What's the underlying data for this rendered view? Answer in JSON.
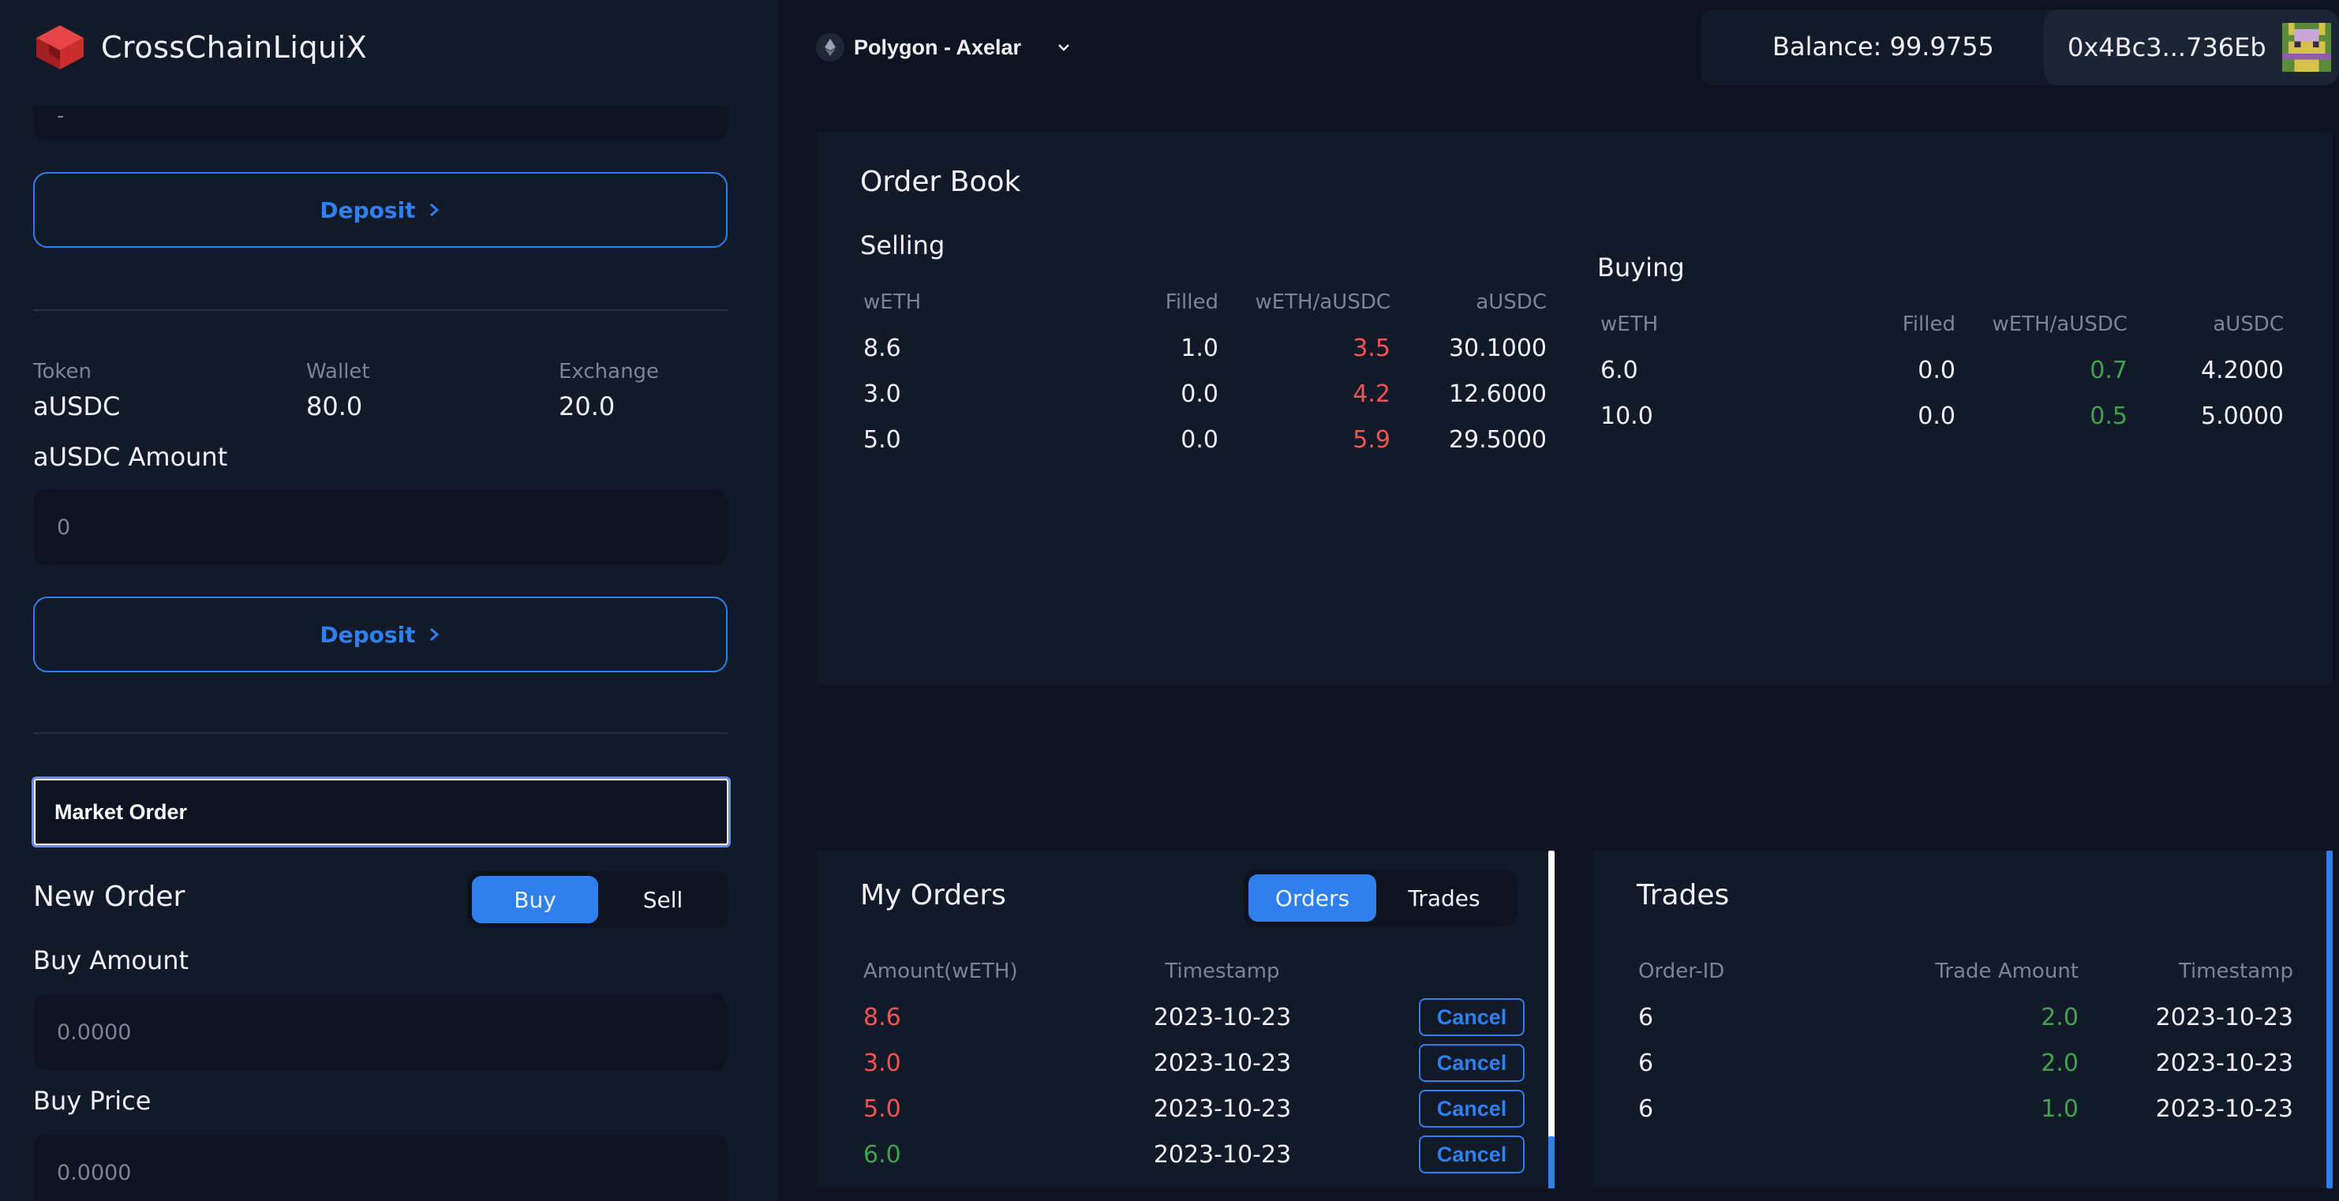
{
  "app": {
    "title": "CrossChainLiquiX"
  },
  "header": {
    "network": "Polygon - Axelar",
    "balance": "Balance: 99.9755",
    "account": "0x4Bc3...736Eb"
  },
  "sidebar": {
    "top_input_value": "-",
    "deposit_label": "Deposit",
    "token_header": "Token",
    "wallet_header": "Wallet",
    "exchange_header": "Exchange",
    "token_name": "aUSDC",
    "wallet_value": "80.0",
    "exchange_value": "20.0",
    "amount_label": "aUSDC Amount",
    "amount_value": "0",
    "deposit2_label": "Deposit",
    "market_order": "Market Order",
    "new_order": "New Order",
    "buy_label": "Buy",
    "sell_label": "Sell",
    "buy_amount_label": "Buy Amount",
    "buy_amount_placeholder": "0.0000",
    "buy_price_label": "Buy Price",
    "buy_price_placeholder": "0.0000"
  },
  "order_book": {
    "title": "Order Book",
    "selling": {
      "title": "Selling",
      "headers": [
        "wETH",
        "Filled",
        "wETH/aUSDC",
        "aUSDC"
      ],
      "rows": [
        [
          "8.6",
          "1.0",
          "3.5",
          "30.1000"
        ],
        [
          "3.0",
          "0.0",
          "4.2",
          "12.6000"
        ],
        [
          "5.0",
          "0.0",
          "5.9",
          "29.5000"
        ]
      ]
    },
    "buying": {
      "title": "Buying",
      "headers": [
        "wETH",
        "Filled",
        "wETH/aUSDC",
        "aUSDC"
      ],
      "rows": [
        [
          "6.0",
          "0.0",
          "0.7",
          "4.2000"
        ],
        [
          "10.0",
          "0.0",
          "0.5",
          "5.0000"
        ]
      ]
    }
  },
  "my_orders": {
    "title": "My Orders",
    "tab_orders": "Orders",
    "tab_trades": "Trades",
    "headers": [
      "Amount(wETH)",
      "Timestamp"
    ],
    "cancel_label": "Cancel",
    "rows": [
      [
        "8.6",
        "2023-10-23"
      ],
      [
        "3.0",
        "2023-10-23"
      ],
      [
        "5.0",
        "2023-10-23"
      ],
      [
        "6.0",
        "2023-10-23"
      ]
    ]
  },
  "trades": {
    "title": "Trades",
    "headers": [
      "Order-ID",
      "Trade Amount",
      "Timestamp"
    ],
    "rows": [
      [
        "6",
        "2.0",
        "2023-10-23"
      ],
      [
        "6",
        "2.0",
        "2023-10-23"
      ],
      [
        "6",
        "1.0",
        "2023-10-23"
      ]
    ]
  },
  "colors": {
    "accent": "#2f80ed",
    "sell": "#f45353",
    "buy": "#3fa34d",
    "panel": "#121a29",
    "background": "#0d1321"
  }
}
